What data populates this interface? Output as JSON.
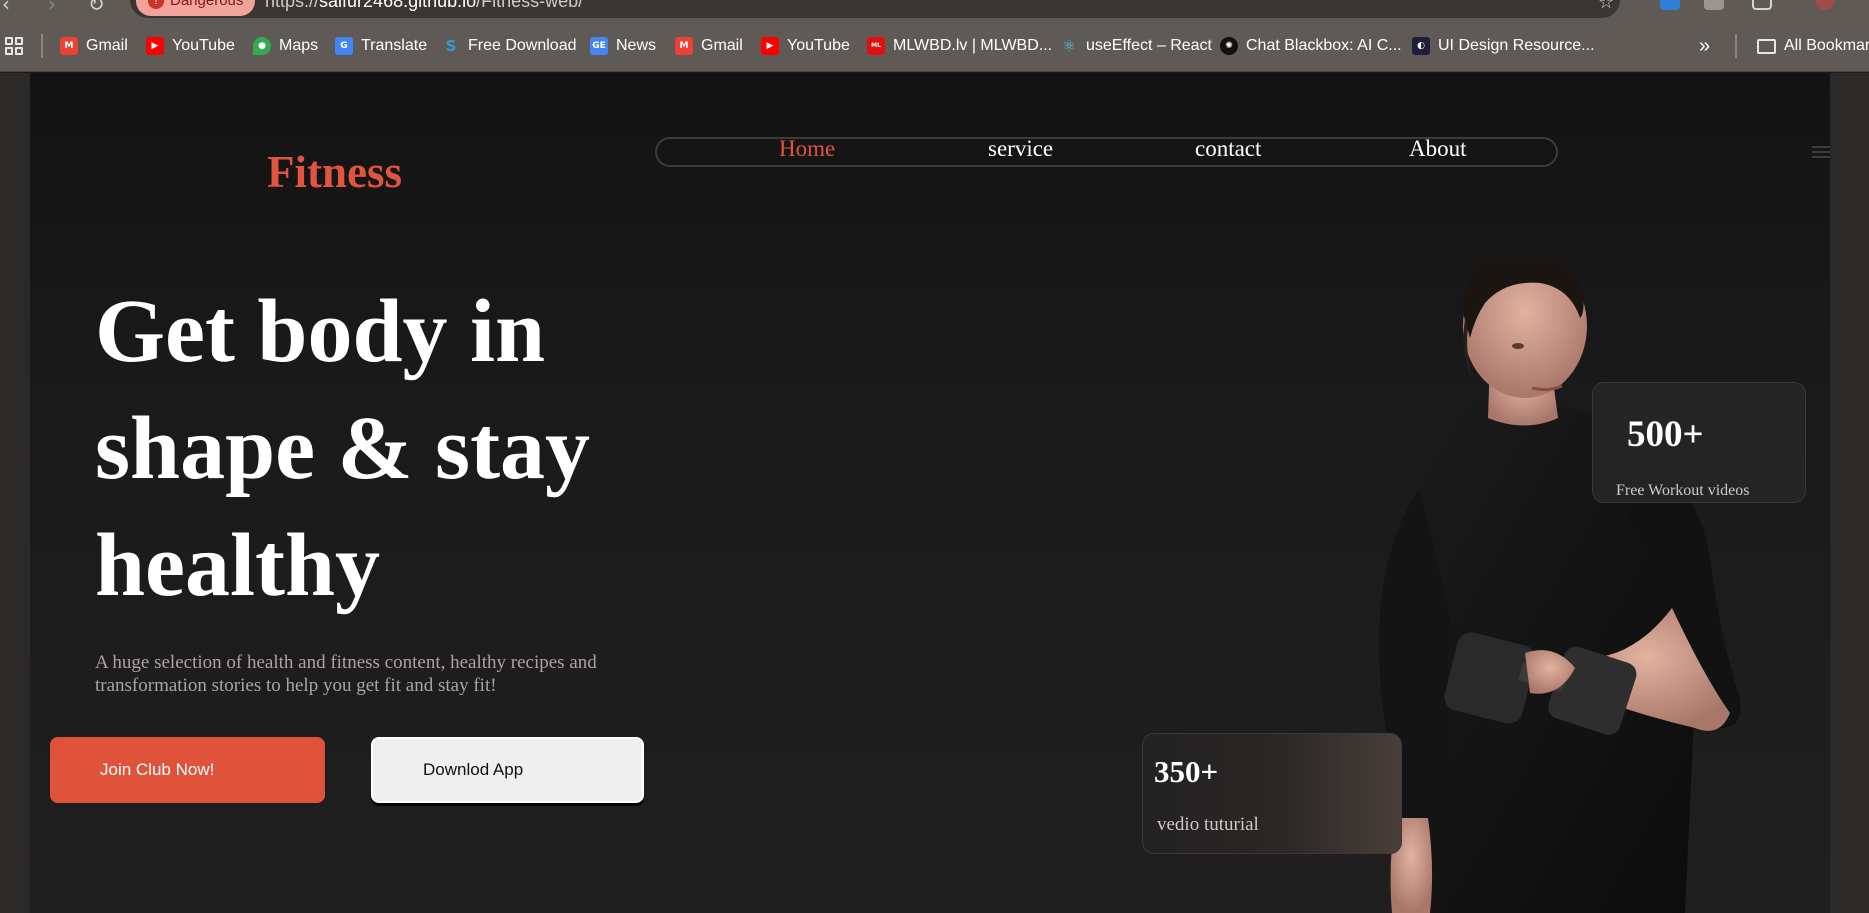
{
  "browser": {
    "danger_label": "Dangerous",
    "url_prefix": "https://",
    "url_host": "saifur2468.github.io",
    "url_path": "/Fitness-web/",
    "bookmarks": [
      {
        "label": "Gmail",
        "icon": "gmail-icon",
        "color": "#ea4335"
      },
      {
        "label": "YouTube",
        "icon": "youtube-icon",
        "color": "#ff0000"
      },
      {
        "label": "Maps",
        "icon": "maps-icon",
        "color": "#34a853"
      },
      {
        "label": "Translate",
        "icon": "translate-icon",
        "color": "#4285f4"
      },
      {
        "label": "Free Download",
        "icon": "free-download-icon",
        "color": "#2d9cdb"
      },
      {
        "label": "News",
        "icon": "news-icon",
        "color": "#4285f4"
      },
      {
        "label": "Gmail",
        "icon": "gmail-icon",
        "color": "#ea4335"
      },
      {
        "label": "YouTube",
        "icon": "youtube-icon",
        "color": "#ff0000"
      },
      {
        "label": "MLWBD.lv | MLWBD...",
        "icon": "mlwbd-icon",
        "color": "#e01010"
      },
      {
        "label": "useEffect – React",
        "icon": "react-icon",
        "color": "#58c4dc"
      },
      {
        "label": "Chat Blackbox: AI C...",
        "icon": "blackbox-icon",
        "color": "#111111"
      },
      {
        "label": "UI Design Resource...",
        "icon": "ui-design-icon",
        "color": "#1e1e3c"
      }
    ],
    "more_label": "»",
    "all_bookmarks_label": "All Bookmarks"
  },
  "site": {
    "logo": "Fitness",
    "nav": [
      {
        "label": "Home",
        "active": true
      },
      {
        "label": "service",
        "active": false
      },
      {
        "label": "contact",
        "active": false
      },
      {
        "label": "About",
        "active": false
      }
    ],
    "headline": "Get body in shape & stay healthy",
    "description": "A huge selection of health and fitness content, healthy recipes and transformation stories to help you get fit and stay fit!",
    "cta_primary": "Join Club Now!",
    "cta_secondary": "Downlod App",
    "stats": [
      {
        "value": "500+",
        "label": "Free Workout videos"
      },
      {
        "value": "350+",
        "label": "vedio tuturial"
      }
    ]
  },
  "colors": {
    "accent": "#e05440",
    "page_bg": "#1b1a1a",
    "chrome_bg": "#5f5a56"
  }
}
